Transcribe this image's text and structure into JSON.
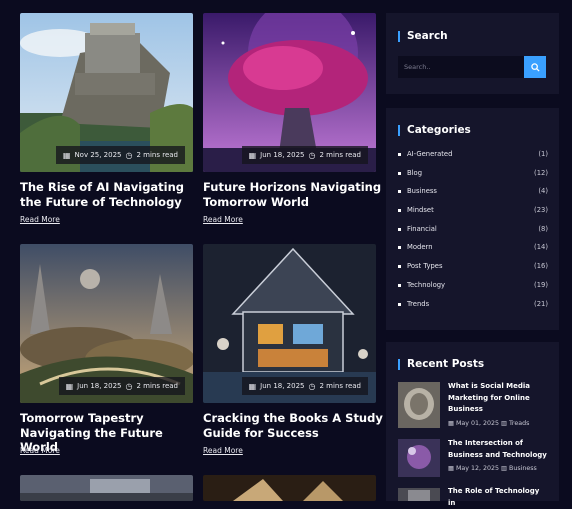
{
  "posts": [
    {
      "title": "The Rise of AI Navigating the Future of Technology",
      "date": "Nov 25, 2025",
      "read_time": "2 mins read",
      "read_more": "Read More"
    },
    {
      "title": "Future Horizons Navigating Tomorrow World",
      "date": "Jun 18, 2025",
      "read_time": "2 mins read",
      "read_more": "Read More"
    },
    {
      "title": "Tomorrow Tapestry Navigating the Future World",
      "date": "Jun 18, 2025",
      "read_time": "2 mins read",
      "read_more": "Read More"
    },
    {
      "title": "Cracking the Books A Study Guide for Success",
      "date": "Jun 18, 2025",
      "read_time": "2 mins read",
      "read_more": "Read More"
    }
  ],
  "sidebar": {
    "search": {
      "heading": "Search",
      "placeholder": "Search.."
    },
    "categories": {
      "heading": "Categories",
      "items": [
        {
          "label": "AI-Generated",
          "count": "(1)"
        },
        {
          "label": "Blog",
          "count": "(12)"
        },
        {
          "label": "Business",
          "count": "(4)"
        },
        {
          "label": "Mindset",
          "count": "(23)"
        },
        {
          "label": "Financial",
          "count": "(8)"
        },
        {
          "label": "Modern",
          "count": "(14)"
        },
        {
          "label": "Post Types",
          "count": "(16)"
        },
        {
          "label": "Technology",
          "count": "(19)"
        },
        {
          "label": "Trends",
          "count": "(21)"
        }
      ]
    },
    "recent": {
      "heading": "Recent Posts",
      "items": [
        {
          "title": "What is Social Media Marketing for Online Business",
          "date": "May 01, 2025",
          "category": "Treads"
        },
        {
          "title": "The Intersection of Business and Technology",
          "date": "May 12, 2025",
          "category": "Business"
        },
        {
          "title": "The Role of Technology in",
          "date": "",
          "category": ""
        }
      ]
    }
  },
  "icons": {
    "date": "calendar-icon",
    "time": "clock-icon",
    "search": "search-icon",
    "category": "square-bullet-icon"
  },
  "colors": {
    "background": "#0b0b1f",
    "panel": "#15152b",
    "accent": "#3aa0ff"
  }
}
